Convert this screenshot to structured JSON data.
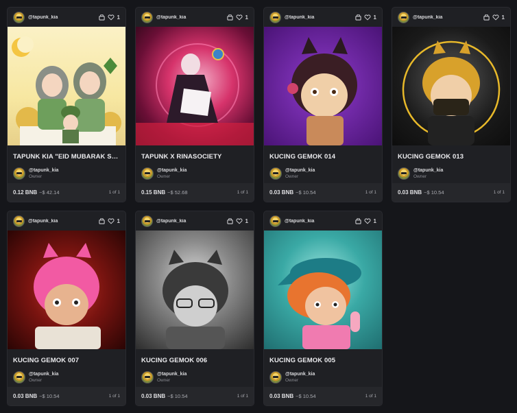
{
  "cards": [
    {
      "handle": "@tapunk_kia",
      "likes": "1",
      "title": "TAPUNK KIA \"EID MUBARAK SPECI...",
      "owner_handle": "@tapunk_kia",
      "owner_role": "Owner",
      "price": "0.12 BNB",
      "usd": "~$ 42.14",
      "edition": "1 of 1"
    },
    {
      "handle": "@tapunk_kia",
      "likes": "1",
      "title": "TAPUNK X RINASOCIETY",
      "owner_handle": "@tapunk_kia",
      "owner_role": "Owner",
      "price": "0.15 BNB",
      "usd": "~$ 52.68",
      "edition": "1 of 1"
    },
    {
      "handle": "@tapunk_kia",
      "likes": "1",
      "title": "KUCING GEMOK 014",
      "owner_handle": "@tapunk_kia",
      "owner_role": "Owner",
      "price": "0.03 BNB",
      "usd": "~$ 10.54",
      "edition": "1 of 1"
    },
    {
      "handle": "@tapunk_kia",
      "likes": "1",
      "title": "KUCING GEMOK 013",
      "owner_handle": "@tapunk_kia",
      "owner_role": "Owner",
      "price": "0.03 BNB",
      "usd": "~$ 10.54",
      "edition": "1 of 1"
    },
    {
      "handle": "@tapunk_kia",
      "likes": "1",
      "title": "KUCING GEMOK 007",
      "owner_handle": "@tapunk_kia",
      "owner_role": "Owner",
      "price": "0.03 BNB",
      "usd": "~$ 10.54",
      "edition": "1 of 1"
    },
    {
      "handle": "@tapunk_kia",
      "likes": "1",
      "title": "KUCING GEMOK 006",
      "owner_handle": "@tapunk_kia",
      "owner_role": "Owner",
      "price": "0.03 BNB",
      "usd": "~$ 10.54",
      "edition": "1 of 1"
    },
    {
      "handle": "@tapunk_kia",
      "likes": "1",
      "title": "KUCING GEMOK 005",
      "owner_handle": "@tapunk_kia",
      "owner_role": "Owner",
      "price": "0.03 BNB",
      "usd": "~$ 10.54",
      "edition": "1 of 1"
    }
  ],
  "icons": {
    "bag": "shopping-bag-icon",
    "like": "heart-icon"
  },
  "colors": {
    "background": "#15161a",
    "card": "#1f2024",
    "footer": "#26272b"
  }
}
